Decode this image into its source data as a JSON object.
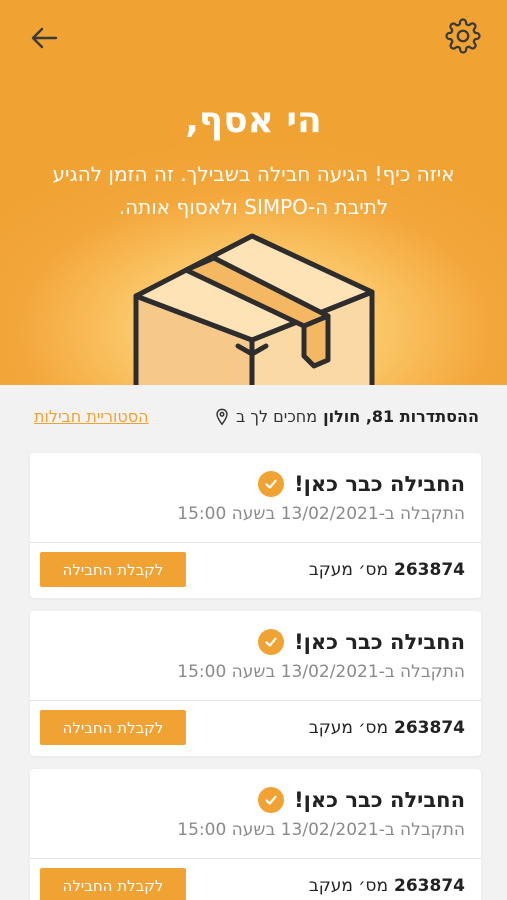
{
  "header": {
    "back_icon": "arrow-left-icon",
    "settings_icon": "gear-icon",
    "greeting": "הי אסף,",
    "message": "איזה כיף! הגיעה חבילה בשבילך. זה הזמן להגיע לתיבת ה-SIMPO ולאסוף אותה."
  },
  "location": {
    "prefix": "מחכים לך ב",
    "address": "ההסתדרות 81, חולון",
    "history_link": "הסטוריית חבילות"
  },
  "packages": [
    {
      "status": "החבילה כבר כאן!",
      "received": "התקבלה ב-13/02/2021 בשעה 15:00",
      "tracking_label": "מס׳ מעקב",
      "tracking_number": "263874",
      "button": "לקבלת החבילה"
    },
    {
      "status": "החבילה כבר כאן!",
      "received": "התקבלה ב-13/02/2021 בשעה 15:00",
      "tracking_label": "מס׳ מעקב",
      "tracking_number": "263874",
      "button": "לקבלת החבילה"
    },
    {
      "status": "החבילה כבר כאן!",
      "received": "התקבלה ב-13/02/2021 בשעה 15:00",
      "tracking_label": "מס׳ מעקב",
      "tracking_number": "263874",
      "button": "לקבלת החבילה"
    }
  ],
  "colors": {
    "accent": "#f0a232",
    "background": "#f2f2f2"
  }
}
